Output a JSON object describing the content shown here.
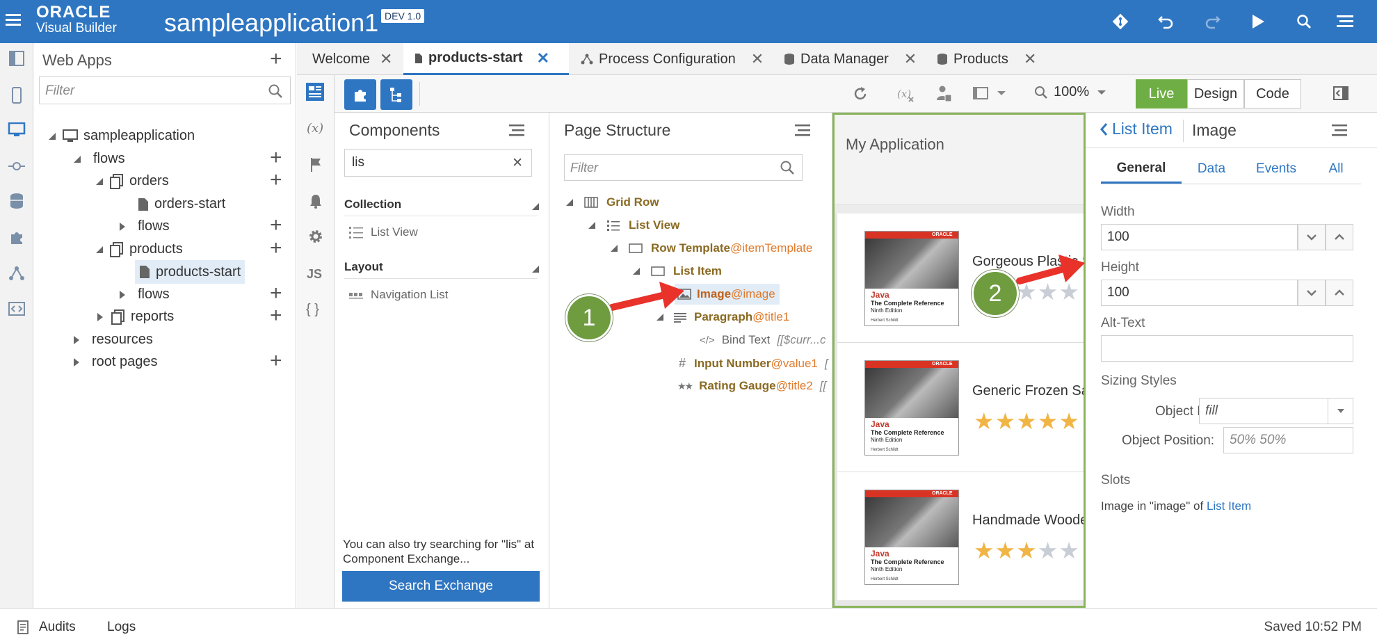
{
  "header": {
    "brand_line1": "ORACLE",
    "brand_line2": "Visual Builder",
    "app_title": "sampleapplication1",
    "badge": "DEV 1.0",
    "color": "#2f76c2"
  },
  "rail": {
    "icons": [
      "collapse-panel-icon",
      "mobile-apps-icon",
      "web-apps-icon",
      "services-icon",
      "business-objects-icon",
      "components-icon",
      "process-icon",
      "source-view-icon"
    ]
  },
  "webapps": {
    "title": "Web Apps",
    "filter_placeholder": "Filter",
    "tree": {
      "app": "sampleapplication",
      "flows": "flows",
      "orders": "orders",
      "orders_start": "orders-start",
      "orders_flows": "flows",
      "products": "products",
      "products_start": "products-start",
      "products_flows": "flows",
      "reports": "reports",
      "resources": "resources",
      "root_pages": "root pages"
    }
  },
  "tabs": [
    {
      "label": "Welcome"
    },
    {
      "label": "products-start"
    },
    {
      "label": "Process Configuration"
    },
    {
      "label": "Data Manager"
    },
    {
      "label": "Products"
    }
  ],
  "rail2": {
    "variables": "(x)",
    "js": "JS",
    "json": "{ }"
  },
  "toolbar": {
    "zoom": "100%",
    "live": "Live",
    "design": "Design",
    "code": "Code",
    "live_color": "#6fae45"
  },
  "components": {
    "title": "Components",
    "search_value": "lis",
    "section_collection": "Collection",
    "item_list_view": "List View",
    "section_layout": "Layout",
    "item_navigation_list": "Navigation List",
    "hint": "You can also try searching for \"lis\" at Component Exchange...",
    "search_exchange": "Search Exchange"
  },
  "structure": {
    "title": "Page Structure",
    "filter_placeholder": "Filter",
    "nodes": {
      "grid_row": "Grid Row",
      "list_view": "List View",
      "row_template": "Row Template",
      "row_template_ref": "@itemTemplate",
      "list_item": "List Item",
      "image": "Image",
      "image_ref": "@image",
      "paragraph": "Paragraph",
      "paragraph_ref": "@title1",
      "bind_text": "Bind Text",
      "bind_text_value": "[[$curr...c",
      "input_number": "Input Number",
      "input_number_ref": "@value1",
      "input_number_value": "[",
      "rating_gauge": "Rating Gauge",
      "rating_gauge_ref": "@title2",
      "rating_gauge_value": "[["
    }
  },
  "canvas": {
    "app_title": "My Application",
    "book": {
      "brand": "ORACLE",
      "title": "Java",
      "subtitle": "The Complete Reference",
      "edition": "Ninth Edition",
      "author": "Herbert Schildt"
    },
    "items": [
      {
        "title": "Gorgeous Plastic S",
        "rating": 0
      },
      {
        "title": "Generic Frozen Sa",
        "rating": 5
      },
      {
        "title": "Handmade Woode",
        "rating": 3
      }
    ],
    "star_color": "#f0b545",
    "star_empty_color": "#c8cdd6"
  },
  "props": {
    "back_label": "List Item",
    "title": "Image",
    "tabs": [
      "General",
      "Data",
      "Events",
      "All"
    ],
    "width_label": "Width",
    "width_value": "100",
    "height_label": "Height",
    "height_value": "100",
    "alt_text_label": "Alt-Text",
    "alt_text_value": "",
    "sizing_styles_label": "Sizing Styles",
    "object_fit_label": "Object Fit:",
    "object_fit_value": "fill",
    "object_position_label": "Object Position:",
    "object_position_placeholder": "50% 50%",
    "slots_label": "Slots",
    "slots_text": "Image in \"image\" of",
    "slots_link": "List Item"
  },
  "footer": {
    "audits": "Audits",
    "logs": "Logs",
    "saved": "Saved 10:52 PM"
  },
  "callouts": [
    "1",
    "2"
  ],
  "annotation_color": "#e8322a"
}
